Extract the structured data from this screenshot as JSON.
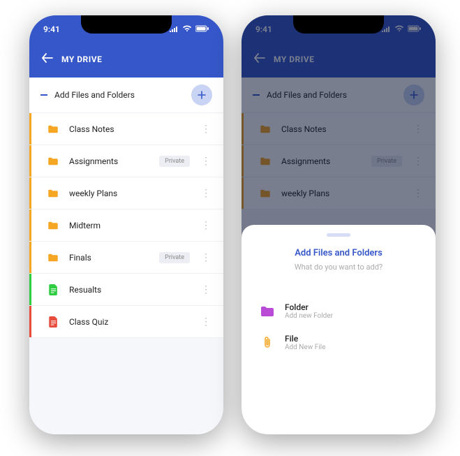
{
  "status": {
    "time": "9:41"
  },
  "header": {
    "title": "MY DRIVE"
  },
  "addRow": {
    "label": "Add Files and Folders"
  },
  "items": [
    {
      "label": "Class Notes",
      "stripe": "orange",
      "icon": "folder",
      "badge": null
    },
    {
      "label": "Assignments",
      "stripe": "orange",
      "icon": "folder",
      "badge": "Private"
    },
    {
      "label": "weekly Plans",
      "stripe": "orange",
      "icon": "folder",
      "badge": null
    },
    {
      "label": "Midterm",
      "stripe": "orange",
      "icon": "folder",
      "badge": null
    },
    {
      "label": "Finals",
      "stripe": "orange",
      "icon": "folder",
      "badge": "Private"
    },
    {
      "label": "Resualts",
      "stripe": "green",
      "icon": "file-green",
      "badge": null
    },
    {
      "label": "Class Quiz",
      "stripe": "red",
      "icon": "file-red",
      "badge": null
    }
  ],
  "sheet": {
    "title": "Add Files and Folders",
    "subtitle": "What do you want to add?",
    "options": [
      {
        "title": "Folder",
        "subtitle": "Add new Folder",
        "icon": "folder-purple"
      },
      {
        "title": "File",
        "subtitle": "Add New File",
        "icon": "attach"
      }
    ]
  },
  "rightItems": [
    {
      "label": "Class Notes",
      "stripe": "orange",
      "icon": "folder",
      "badge": null
    },
    {
      "label": "Assignments",
      "stripe": "orange",
      "icon": "folder",
      "badge": "Private"
    },
    {
      "label": "weekly Plans",
      "stripe": "orange",
      "icon": "folder",
      "badge": null
    }
  ]
}
